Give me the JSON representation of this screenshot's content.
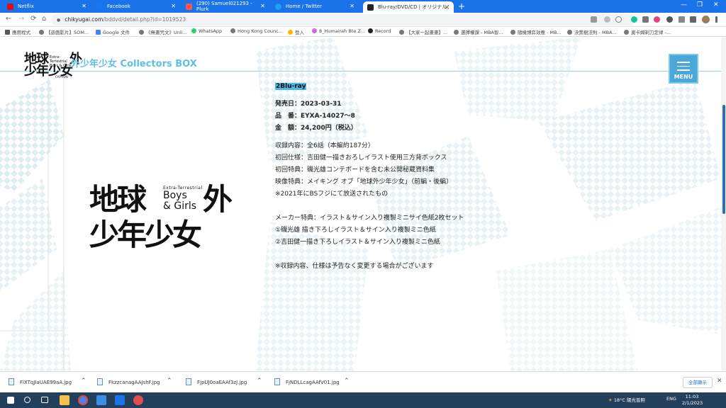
{
  "tabs": [
    {
      "label": "Netflix",
      "color": "#e50914",
      "active": false
    },
    {
      "label": "Facebook",
      "color": "#1877f2",
      "active": false
    },
    {
      "label": "(290) Samuel021293 - Plurk",
      "color": "#ff574d",
      "active": false
    },
    {
      "label": "Home / Twitter",
      "color": "#1da1f2",
      "active": false
    },
    {
      "label": "Blu-ray/DVD/CD | オリジナルア",
      "color": "#222222",
      "active": true
    }
  ],
  "new_tab": "+",
  "window_controls": {
    "minimize": "—",
    "maximize": "❐",
    "close": "✕"
  },
  "nav": {
    "back": "←",
    "forward": "→",
    "reload": "⟳",
    "home": "⌂"
  },
  "address": {
    "lock": "🔒",
    "host": "chikyugai.com",
    "path": "/bddvd/detail.php?id=1019523"
  },
  "bookmarks": [
    "應用程式",
    "【遊戲影片】SOM...",
    "Google 文件",
    "《無畫咒文》Unli...",
    "WhatsApp",
    "Hong Kong Counc...",
    "登入",
    "8_Humairah Bte Z...",
    "Record",
    "【大家一起畫畫】...",
    "選擇權課 - MBA智...",
    "隨機博弈效應 - MB...",
    "決策樹法則 - MBA...",
    "奧卡姆剃刀定律 -..."
  ],
  "site": {
    "logo_line1": "地球",
    "logo_line2": "少年少女",
    "logo_gaiji": "外",
    "logo_tiny": "Extra-Terrestrial Boys & Girls",
    "logo_tiny2": "CAPTION",
    "title": "外少年少女 Collectors BOX",
    "menu_label": "MENU"
  },
  "cover": {
    "row1": "地球",
    "row2": "少年少女",
    "gaiji": "外",
    "sub": "Extra-Terrestrial",
    "boys": "Boys",
    "girls": "& Girls"
  },
  "product": {
    "format": "2Blu-ray",
    "release": "発売日：2023-03-31",
    "code": "品　番：EYXA-14027〜8",
    "price": "金　額：24,200円（税込）",
    "lines": [
      "収録内容：全6話（本編約187分）",
      "初回仕様：吉田健一描きおろしイラスト使用三方背ボックス",
      "初回特典：磯光雄コンテボードを含む未公開秘蔵資料集",
      "映像特典：メイキング オブ「地球外少年少女」（前編・後編）",
      "※2021年にBSフジにて放送されたもの"
    ],
    "bonus": [
      "メーカー特典：イラスト＆サイン入り複製ミニサイ色紙2枚セット",
      "①磯光雄 描き下ろしイラスト＆サイン入り複製ミニ色紙",
      "②吉田健一描き下ろしイラスト＆サイン入り複製ミニ色紙"
    ],
    "note": "※収録内容、仕様は予告なく変更する場合がございます"
  },
  "downloads": [
    "FlXTqJIaUAE99aA.jpg",
    "FkzzcanagAAJshF.jpg",
    "FjpUJ0oaEAAf3zJ.jpg",
    "FjNDLLcagAAfV01.jpg"
  ],
  "downloads_show_all": "全部顯示",
  "taskbar": {
    "weather": "18°C 陽光普照",
    "lang": "ENG",
    "time": "11:03",
    "date": "2/1/2023"
  }
}
